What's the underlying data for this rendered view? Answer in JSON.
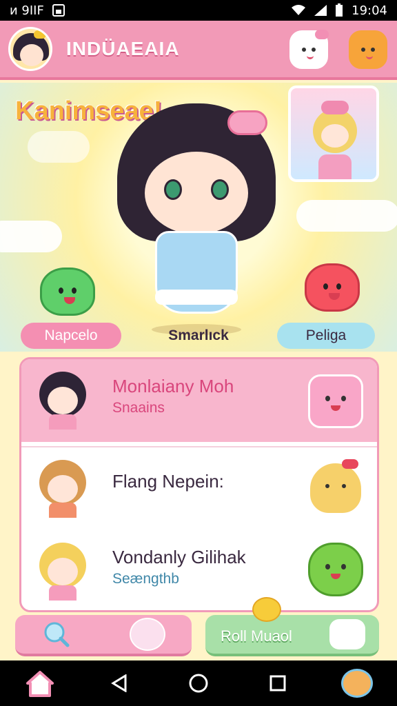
{
  "status_bar": {
    "left_text": "ᴎ 9IIF",
    "time": "19:04"
  },
  "app_bar": {
    "title": "INDÜAEAIA"
  },
  "hero": {
    "title": "Kanimseae!"
  },
  "characters": [
    {
      "label": "Napcelo",
      "color": "#f58fb0"
    },
    {
      "label": "Smarlıck",
      "color": "#3a2940"
    },
    {
      "label": "Peliga",
      "color": "#8fdbea"
    }
  ],
  "list": {
    "items": [
      {
        "title": "Monlaiany Moh",
        "subtitle": "Snaains",
        "highlighted": true,
        "avatar_hair": "#2e2436",
        "icon": "pink-blob-icon"
      },
      {
        "title": "Flang Nepein:",
        "subtitle": "",
        "highlighted": false,
        "avatar_hair": "#d99a52",
        "icon": "hamster-icon"
      },
      {
        "title": "Vondanly Gilihak",
        "subtitle": "Seængthb",
        "highlighted": false,
        "avatar_hair": "#f4d05c",
        "icon": "green-blob-icon"
      }
    ]
  },
  "bottom_buttons": {
    "roll_label": "Roll Muaol"
  },
  "nav": {
    "items": [
      "home-icon",
      "back-icon",
      "home-circle-icon",
      "recents-icon",
      "hamster-icon"
    ]
  },
  "colors": {
    "pink": "#f29ab7",
    "accent_blue": "#3f87a8"
  }
}
